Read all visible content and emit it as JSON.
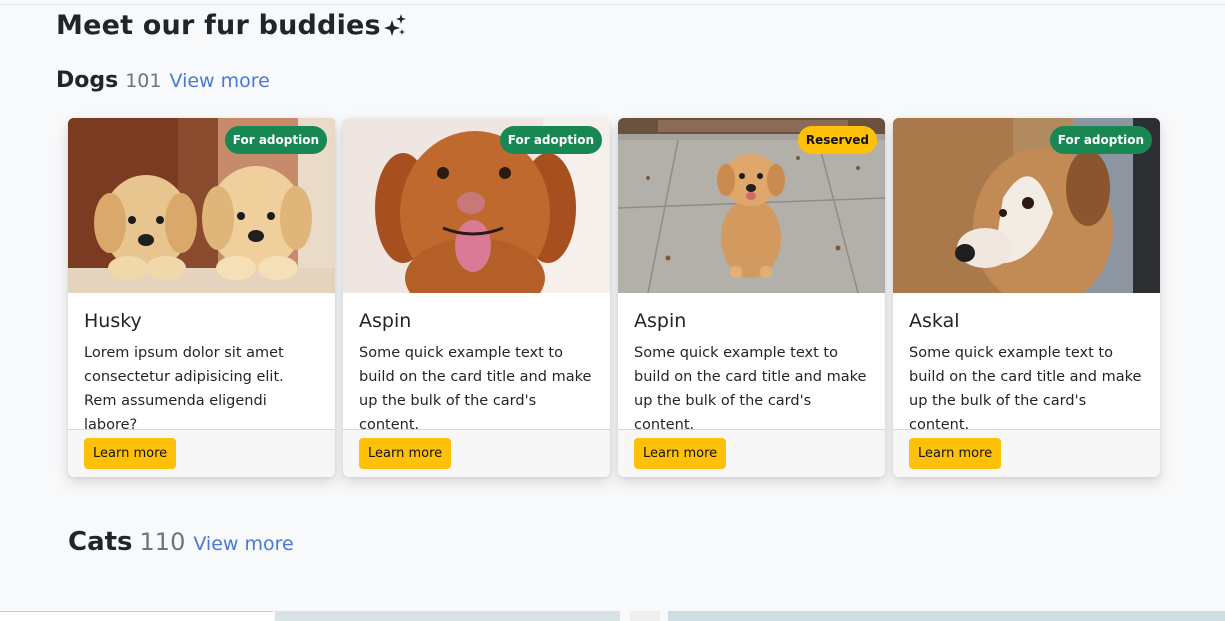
{
  "page": {
    "title": "Meet our fur buddies",
    "title_icon": "sparkles-icon"
  },
  "dogs": {
    "label": "Dogs",
    "count": "101",
    "link": "View more",
    "cards": [
      {
        "badge": "For adoption",
        "badge_color": "#198754",
        "title": "Husky",
        "text": "Lorem ipsum dolor sit amet consectetur adipisicing elit. Rem assumenda eligendi labore?",
        "button": "Learn more"
      },
      {
        "badge": "For adoption",
        "badge_color": "#198754",
        "title": "Aspin",
        "text": "Some quick example text to build on the card title and make up the bulk of the card's content.",
        "button": "Learn more"
      },
      {
        "badge": "Reserved",
        "badge_color": "#ffc107",
        "title": "Aspin",
        "text": "Some quick example text to build on the card title and make up the bulk of the card's content.",
        "button": "Learn more"
      },
      {
        "badge": "For adoption",
        "badge_color": "#198754",
        "title": "Askal",
        "text": "Some quick example text to build on the card title and make up the bulk of the card's content.",
        "button": "Learn more"
      }
    ]
  },
  "cats": {
    "label": "Cats",
    "count": "110",
    "link": "View more"
  },
  "colors": {
    "accent_button": "#ffc107",
    "badge_green": "#198754",
    "link": "#4a78d6",
    "background": "#f8f9fa"
  }
}
